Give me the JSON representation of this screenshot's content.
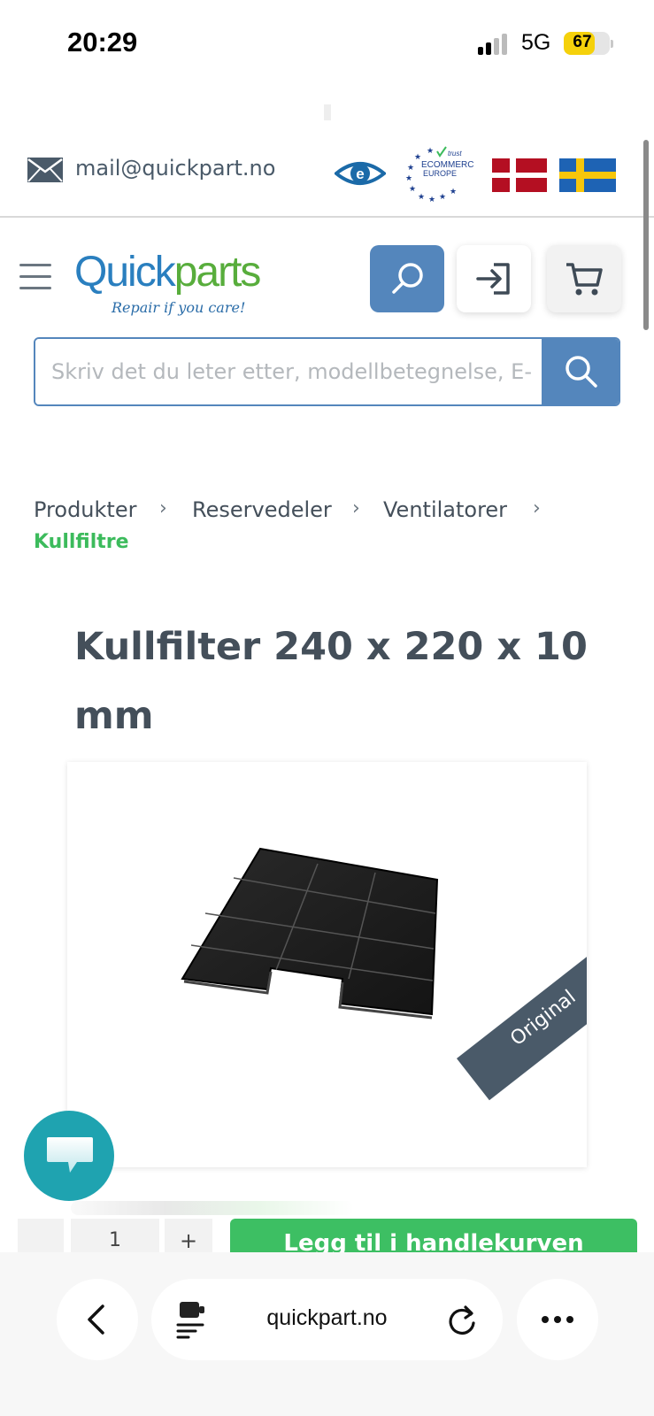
{
  "status_bar": {
    "time": "20:29",
    "network": "5G",
    "battery": "67",
    "battery_level": 0.67
  },
  "top_bar": {
    "email": "mail@quickpart.no",
    "trust_badge": {
      "small": "trust",
      "line1": "ECOMMERCE",
      "line2": "EUROPE"
    }
  },
  "header": {
    "logo": {
      "word_part1": "Quick",
      "word_part2": "parts",
      "tagline": "Repair if you care!"
    },
    "icons": [
      "menu-icon",
      "search-icon",
      "login-icon",
      "cart-icon"
    ]
  },
  "search": {
    "placeholder": "Skriv det du leter etter, modellbetegnelse, E-"
  },
  "breadcrumb": {
    "items": [
      "Produkter",
      "Reservedeler",
      "Ventilatorer"
    ],
    "separator": "›",
    "current": "Kullfiltre"
  },
  "product": {
    "title": "Kullfilter 240 x 220 x 10 mm",
    "ribbon": "Original"
  },
  "cart_row": {
    "qty_minus": "-",
    "qty": "1",
    "qty_plus": "+",
    "add_label": "Legg til i handlekurven"
  },
  "browser": {
    "url": "quickpart.no"
  },
  "colors": {
    "brand_blue": "#5486bc",
    "brand_green": "#3dbf63",
    "text": "#444f5a",
    "chat": "#1fa3b0"
  }
}
